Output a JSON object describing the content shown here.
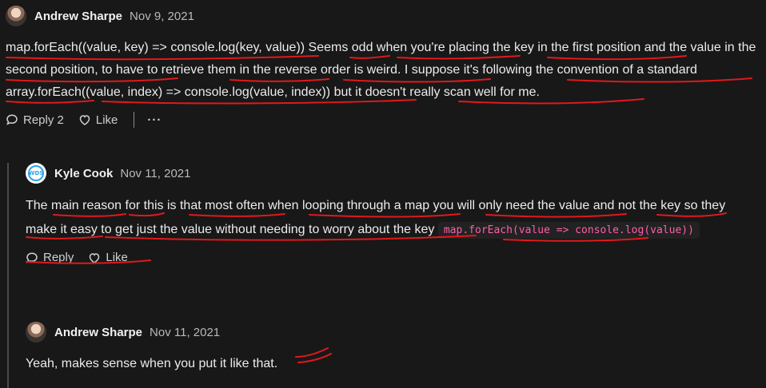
{
  "comments": [
    {
      "author": "Andrew Sharpe",
      "date": "Nov 9, 2021",
      "body": "map.forEach((value, key) => console.log(key, value)) Seems odd when you're placing the key in the first position and the value in the second position, to have to retrieve them in the reverse order is weird. I suppose it's following the convention of a standard array.forEach((value, index) => console.log(value, index)) but it doesn't really scan well for me.",
      "reply_label": "Reply 2",
      "like_label": "Like",
      "more_label": "···"
    },
    {
      "author": "Kyle Cook",
      "date": "Nov 11, 2021",
      "body_text": "The main reason for this is that most often when looping through a map you will only need the value and not the key so they make it easy to get just the value without needing to worry about the key ",
      "code": "map.forEach(value => console.log(value))",
      "reply_label": "Reply",
      "like_label": "Like",
      "avatar_text": "WDS"
    },
    {
      "author": "Andrew Sharpe",
      "date": "Nov 11, 2021",
      "body": "Yeah, makes sense when you put it like that."
    }
  ],
  "colors": {
    "background": "#181818",
    "annotation": "#e0191c",
    "code_text": "#ff5ea8"
  },
  "icons": [
    "speech-bubble-icon",
    "heart-icon",
    "more-dots-icon",
    "wds-logo-icon"
  ]
}
